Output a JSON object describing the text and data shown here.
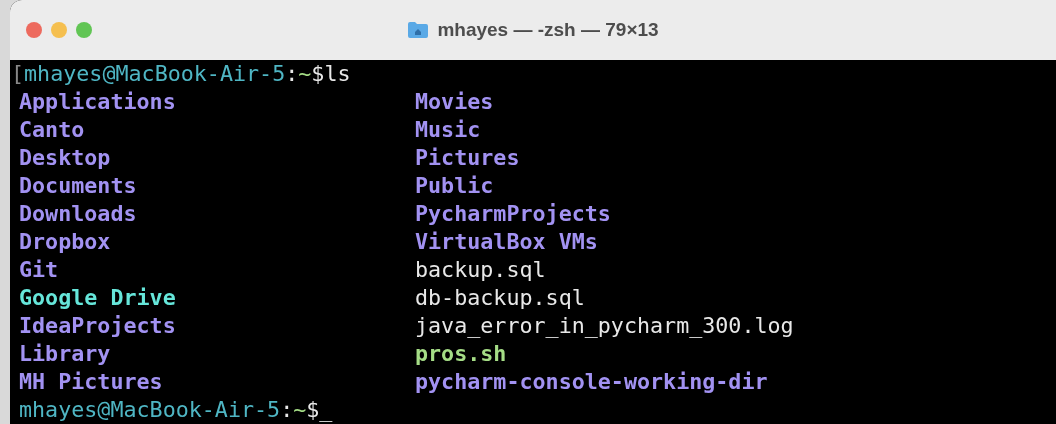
{
  "window": {
    "title": "mhayes — -zsh — 79×13"
  },
  "prompts": [
    {
      "prefix": "[",
      "user_host": "mhayes@MacBook-Air-5",
      "colon": ":",
      "path": "~",
      "symbol": "$",
      "command": "ls"
    },
    {
      "user_host": "mhayes@MacBook-Air-5",
      "colon": ":",
      "path": "~",
      "symbol": "$",
      "cursor": "_"
    }
  ],
  "listing": {
    "columns": [
      [
        {
          "name": "Applications",
          "kind": "dir"
        },
        {
          "name": "Canto",
          "kind": "dir"
        },
        {
          "name": "Desktop",
          "kind": "dir"
        },
        {
          "name": "Documents",
          "kind": "dir"
        },
        {
          "name": "Downloads",
          "kind": "dir"
        },
        {
          "name": "Dropbox",
          "kind": "dir"
        },
        {
          "name": "Git",
          "kind": "dir"
        },
        {
          "name": "Google Drive",
          "kind": "link"
        },
        {
          "name": "IdeaProjects",
          "kind": "dir"
        },
        {
          "name": "Library",
          "kind": "dir"
        },
        {
          "name": "MH Pictures",
          "kind": "dir"
        }
      ],
      [
        {
          "name": "Movies",
          "kind": "dir"
        },
        {
          "name": "Music",
          "kind": "dir"
        },
        {
          "name": "Pictures",
          "kind": "dir"
        },
        {
          "name": "Public",
          "kind": "dir"
        },
        {
          "name": "PycharmProjects",
          "kind": "dir"
        },
        {
          "name": "VirtualBox VMs",
          "kind": "dir"
        },
        {
          "name": "backup.sql",
          "kind": "file"
        },
        {
          "name": "db-backup.sql",
          "kind": "file"
        },
        {
          "name": "java_error_in_pycharm_300.log",
          "kind": "file"
        },
        {
          "name": "pros.sh",
          "kind": "exec"
        },
        {
          "name": "pycharm-console-working-dir",
          "kind": "dir"
        }
      ]
    ]
  }
}
